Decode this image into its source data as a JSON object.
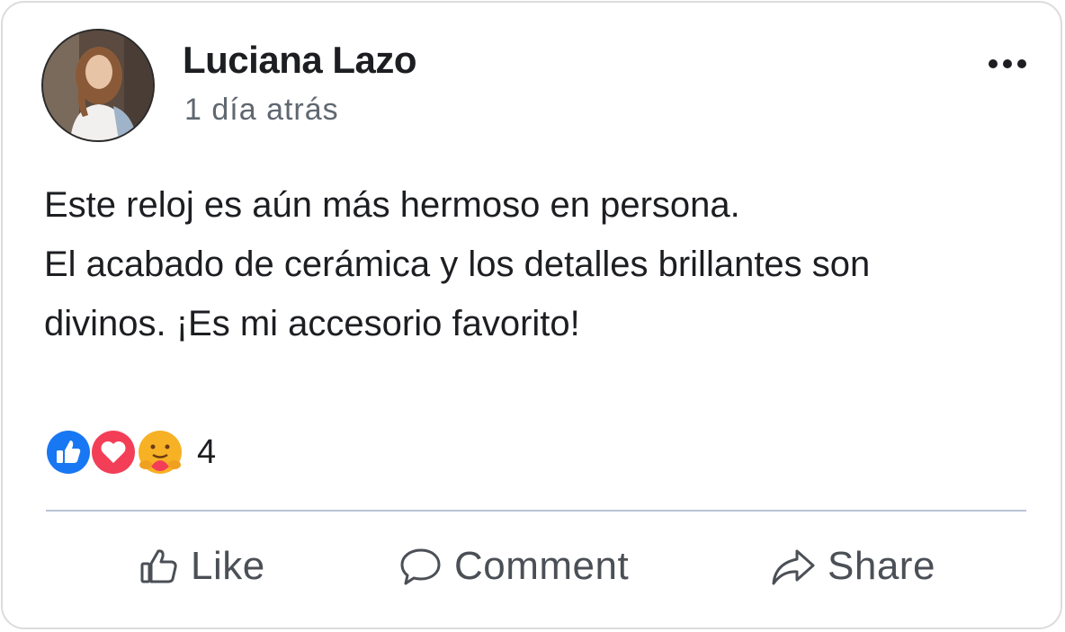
{
  "post": {
    "author": "Luciana Lazo",
    "timestamp": "1 día atrás",
    "menu_icon": "more-horizontal-icon",
    "text_lines": [
      "Este reloj es aún más hermoso en persona.",
      "El acabado de cerámica y los detalles brillantes son",
      "divinos. ¡Es mi accesorio favorito!"
    ]
  },
  "reactions": {
    "icons": [
      "like-reaction-icon",
      "love-reaction-icon",
      "care-reaction-icon"
    ],
    "count": "4"
  },
  "actions": {
    "like_label": "Like",
    "comment_label": "Comment",
    "share_label": "Share"
  },
  "colors": {
    "like_blue": "#1877f2",
    "love_red": "#f33e58",
    "care_yellow": "#f7b125",
    "divider": "#b9c4d6"
  }
}
